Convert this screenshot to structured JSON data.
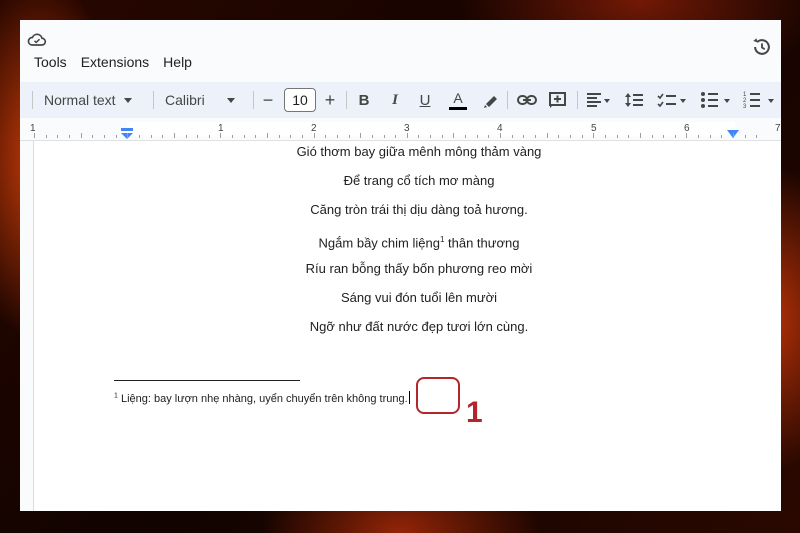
{
  "menu": {
    "tools": "Tools",
    "extensions": "Extensions",
    "help": "Help"
  },
  "toolbar": {
    "style": "Normal text",
    "font": "Calibri",
    "font_size": "10",
    "minus": "−",
    "plus": "+",
    "bold": "B",
    "italic": "I",
    "underline": "U",
    "text_color": "A"
  },
  "ruler": {
    "numbers": [
      "1",
      "1",
      "2",
      "3",
      "4",
      "5",
      "6",
      "7"
    ]
  },
  "document": {
    "lines": [
      "Gió thơm bay giữa mênh mông thảm vàng",
      "Để trang cổ tích mơ màng",
      "Căng tròn trái thị dịu dàng toả hương."
    ],
    "line4_before": "Ngắm bầy chim liệng",
    "line4_sup": "1",
    "line4_after": " thân thương",
    "lines2": [
      "Ríu ran bỗng thấy bốn phương reo mời",
      "Sáng vui đón tuổi lên mười",
      "Ngỡ như đất nước đẹp tươi lớn cùng."
    ],
    "footnote_num": "1",
    "footnote_text": " Liệng: bay lượn nhẹ nhàng, uyển chuyển trên không trung."
  },
  "annotation": {
    "number": "1",
    "color": "#b3262b"
  }
}
